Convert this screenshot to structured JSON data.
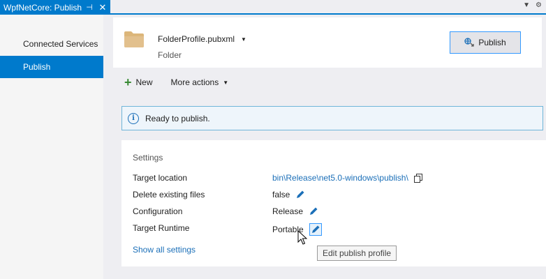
{
  "tab": {
    "title": "WpfNetCore: Publish",
    "pin_glyph": "⊣",
    "close_glyph": "✕"
  },
  "strip": {
    "dropdown_glyph": "▼",
    "settings_glyph": "⚙"
  },
  "sidebar": {
    "items": [
      {
        "label": "Connected Services"
      },
      {
        "label": "Publish"
      }
    ]
  },
  "profile": {
    "name": "FolderProfile.pubxml",
    "type": "Folder",
    "publish_label": "Publish"
  },
  "actions": {
    "new_label": "New",
    "more_label": "More actions"
  },
  "info": {
    "icon_glyph": "i",
    "message": "Ready to publish."
  },
  "settings": {
    "title": "Settings",
    "rows": [
      {
        "label": "Target location",
        "value": "bin\\Release\\net5.0-windows\\publish\\"
      },
      {
        "label": "Delete existing files",
        "value": "false"
      },
      {
        "label": "Configuration",
        "value": "Release"
      },
      {
        "label": "Target Runtime",
        "value": "Portable"
      }
    ],
    "show_all_label": "Show all settings"
  },
  "tooltip": {
    "text": "Edit publish profile"
  },
  "colors": {
    "accent": "#007acc",
    "link": "#1b6fb8",
    "plus_green": "#388a34"
  }
}
